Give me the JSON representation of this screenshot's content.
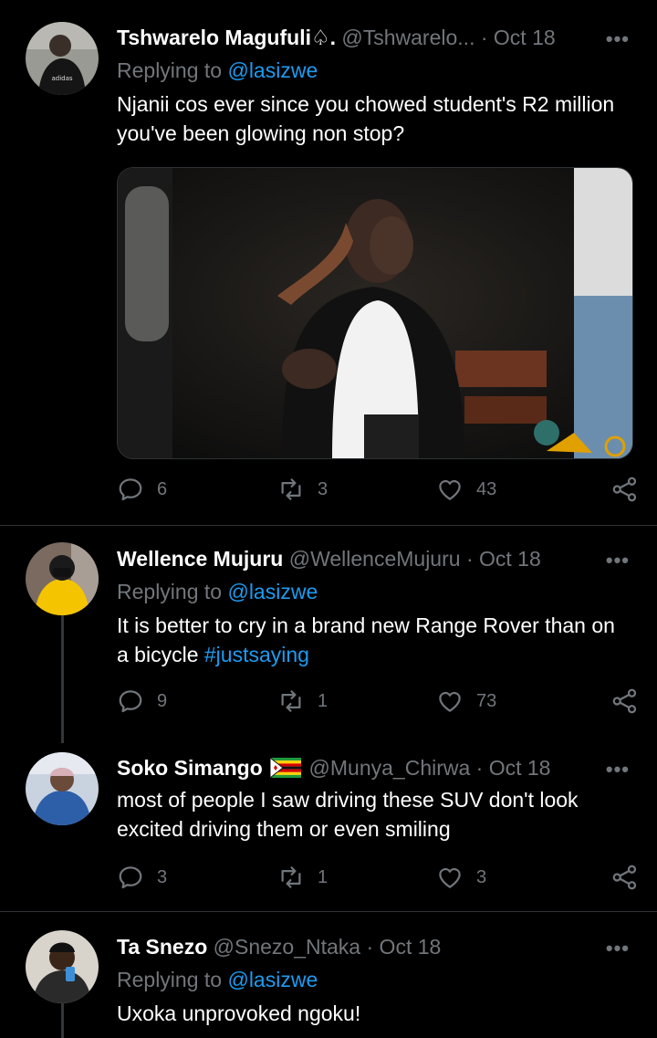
{
  "tweets": [
    {
      "name": "Tshwarelo Magufuli",
      "name_suffix": "♤.",
      "handle": "@Tshwarelo...",
      "date": "· Oct 18",
      "replying_prefix": "Replying to",
      "replying_to": "@lasizwe",
      "text": "Njanii cos ever since you chowed student's R2 million you've been glowing non stop?",
      "has_media": true,
      "replies": "6",
      "retweets": "3",
      "likes": "43"
    },
    {
      "name": "Wellence Mujuru",
      "handle": "@WellenceMujuru",
      "date": "· Oct 18",
      "replying_prefix": "Replying to",
      "replying_to": "@lasizwe",
      "text": "It is better to cry in a brand new Range Rover than on a bicycle",
      "hashtag": "#justsaying",
      "replies": "9",
      "retweets": "1",
      "likes": "73"
    },
    {
      "name": "Soko Simango",
      "handle": "@Munya_Chirwa",
      "date": "· Oct 18",
      "text": "most of people I saw driving these SUV don't look excited driving them or even smiling",
      "replies": "3",
      "retweets": "1",
      "likes": "3"
    },
    {
      "name": "Ta Snezo",
      "handle": "@Snezo_Ntaka",
      "date": "· Oct 18",
      "replying_prefix": "Replying to",
      "replying_to": "@lasizwe",
      "text": "Uxoka unprovoked ngoku!"
    }
  ],
  "more_label": "•••",
  "colors": {
    "background": "#000000",
    "muted": "#71767b",
    "link": "#1d9bf0",
    "divider": "#2f3336"
  },
  "icons": [
    "reply-icon",
    "retweet-icon",
    "like-icon",
    "share-icon",
    "more-icon",
    "zimbabwe-flag-icon"
  ]
}
